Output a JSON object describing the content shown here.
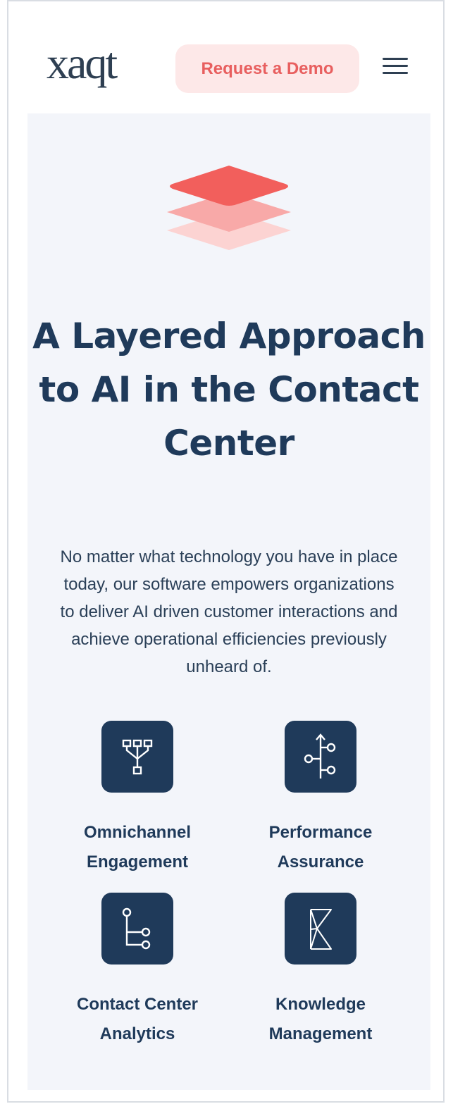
{
  "header": {
    "logo": "xaqt",
    "demo_label": "Request a Demo",
    "menu_icon": "hamburger-menu-icon"
  },
  "hero": {
    "icon": "layers-icon",
    "title": "A Layered Approach to AI in the Contact Center",
    "description": "No matter what technology you have in place today, our software empowers organizations to deliver AI driven customer interactions and achieve operational efficiencies previously unheard of."
  },
  "features": [
    {
      "icon": "omnichannel-network-icon",
      "label": "Omnichannel Engagement"
    },
    {
      "icon": "performance-branch-icon",
      "label": "Performance Assurance"
    },
    {
      "icon": "analytics-flow-icon",
      "label": "Contact Center Analytics"
    },
    {
      "icon": "knowledge-k-icon",
      "label": "Knowledge Management"
    }
  ],
  "colors": {
    "brand_navy": "#1f3a5a",
    "accent_coral": "#f25f5c",
    "button_bg": "#fde8e8",
    "panel_bg": "#f3f5fa"
  }
}
